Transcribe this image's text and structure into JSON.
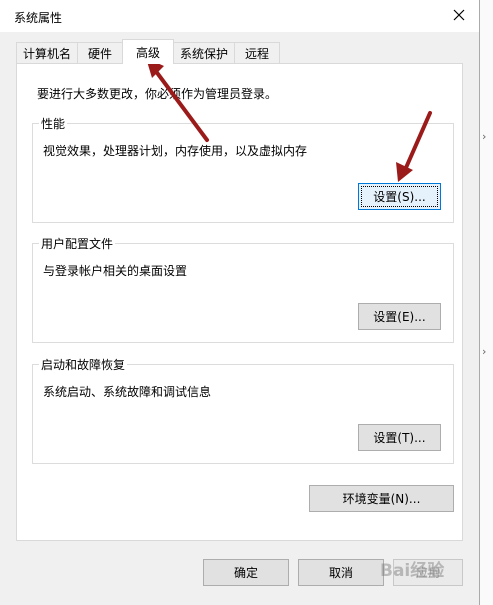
{
  "window": {
    "title": "系统属性"
  },
  "tabs": [
    {
      "label": "计算机名"
    },
    {
      "label": "硬件"
    },
    {
      "label": "高级",
      "active": true
    },
    {
      "label": "系统保护"
    },
    {
      "label": "远程"
    }
  ],
  "admin_note": "要进行大多数更改，你必须作为管理员登录。",
  "groups": {
    "performance": {
      "title": "性能",
      "desc": "视觉效果，处理器计划，内存使用，以及虚拟内存",
      "button": "设置(S)..."
    },
    "profile": {
      "title": "用户配置文件",
      "desc": "与登录帐户相关的桌面设置",
      "button": "设置(E)..."
    },
    "startup": {
      "title": "启动和故障恢复",
      "desc": "系统启动、系统故障和调试信息",
      "button": "设置(T)..."
    }
  },
  "env_button": "环境变量(N)...",
  "footer": {
    "ok": "确定",
    "cancel": "取消",
    "apply": "应用"
  },
  "watermark": "Bai经验",
  "annotation_color": "#9b1b1b"
}
